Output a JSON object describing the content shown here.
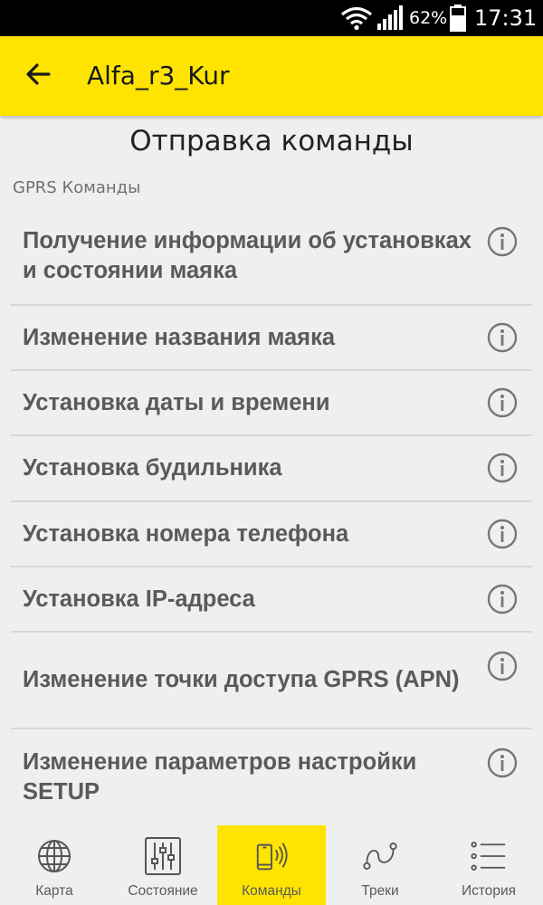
{
  "status_bar": {
    "battery_percent": "62%",
    "time": "17:31",
    "icons": [
      "wifi-icon",
      "signal-icon",
      "battery-icon"
    ]
  },
  "header": {
    "back_icon": "arrow-back-icon",
    "title": "Alfa_r3_Kur"
  },
  "page": {
    "title": "Отправка команды",
    "section_label": "GPRS Команды"
  },
  "commands": [
    {
      "label": "Получение информации об установках и состоянии маяка",
      "icon": "info-icon"
    },
    {
      "label": "Изменение названия маяка",
      "icon": "info-icon"
    },
    {
      "label": "Установка даты и времени",
      "icon": "info-icon"
    },
    {
      "label": "Установка будильника",
      "icon": "info-icon"
    },
    {
      "label": "Установка номера телефона",
      "icon": "info-icon"
    },
    {
      "label": "Установка IP-адреса",
      "icon": "info-icon"
    },
    {
      "label": "Изменение точки доступа GPRS (APN)",
      "icon": "info-icon"
    },
    {
      "label": "Изменение параметров настройки SETUP",
      "icon": "info-icon"
    }
  ],
  "bottom_nav": {
    "active": "Команды",
    "items": [
      {
        "label": "Карта",
        "icon": "globe-icon"
      },
      {
        "label": "Состояние",
        "icon": "sliders-icon"
      },
      {
        "label": "Команды",
        "icon": "phone-signal-icon"
      },
      {
        "label": "Треки",
        "icon": "route-icon"
      },
      {
        "label": "История",
        "icon": "list-icon"
      }
    ]
  },
  "colors": {
    "accent": "#fee400",
    "background": "#efefef",
    "text_primary": "#5a5a5a",
    "divider": "#d7d7d7"
  }
}
